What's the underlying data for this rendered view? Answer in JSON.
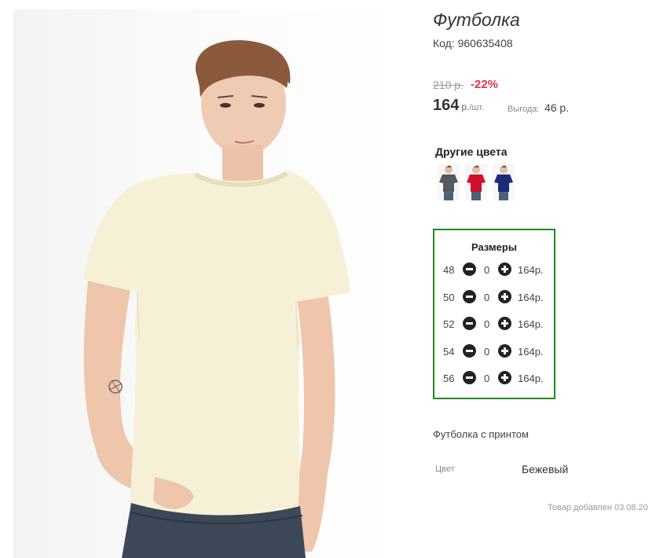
{
  "product": {
    "title": "Футболка",
    "sku_label": "Код:",
    "sku": "960635408",
    "old_price": "210 р.",
    "discount": "-22%",
    "price": "164",
    "unit": "р.",
    "unit_per": "/шт.",
    "savings_label": "Выгода:",
    "savings_value": "46 р."
  },
  "colors": {
    "heading": "Другие цвета",
    "swatches": [
      {
        "name": "gray",
        "color": "#555a5e"
      },
      {
        "name": "red",
        "color": "#d0102c"
      },
      {
        "name": "navy",
        "color": "#1b2a7a"
      }
    ]
  },
  "sizes": {
    "heading": "Размеры",
    "rows": [
      {
        "size": "48",
        "qty": "0",
        "price": "164р."
      },
      {
        "size": "50",
        "qty": "0",
        "price": "164р."
      },
      {
        "size": "52",
        "qty": "0",
        "price": "164р."
      },
      {
        "size": "54",
        "qty": "0",
        "price": "164р."
      },
      {
        "size": "56",
        "qty": "0",
        "price": "164р."
      }
    ],
    "border_color": "#1f8a1f"
  },
  "details": {
    "description": "Футболка с принтом",
    "color_label": "Цвет",
    "color_value": "Бежевый",
    "added": "Товар добавлен 03.08.20"
  },
  "photo": {
    "shirt_color": "#f6f1d6"
  }
}
